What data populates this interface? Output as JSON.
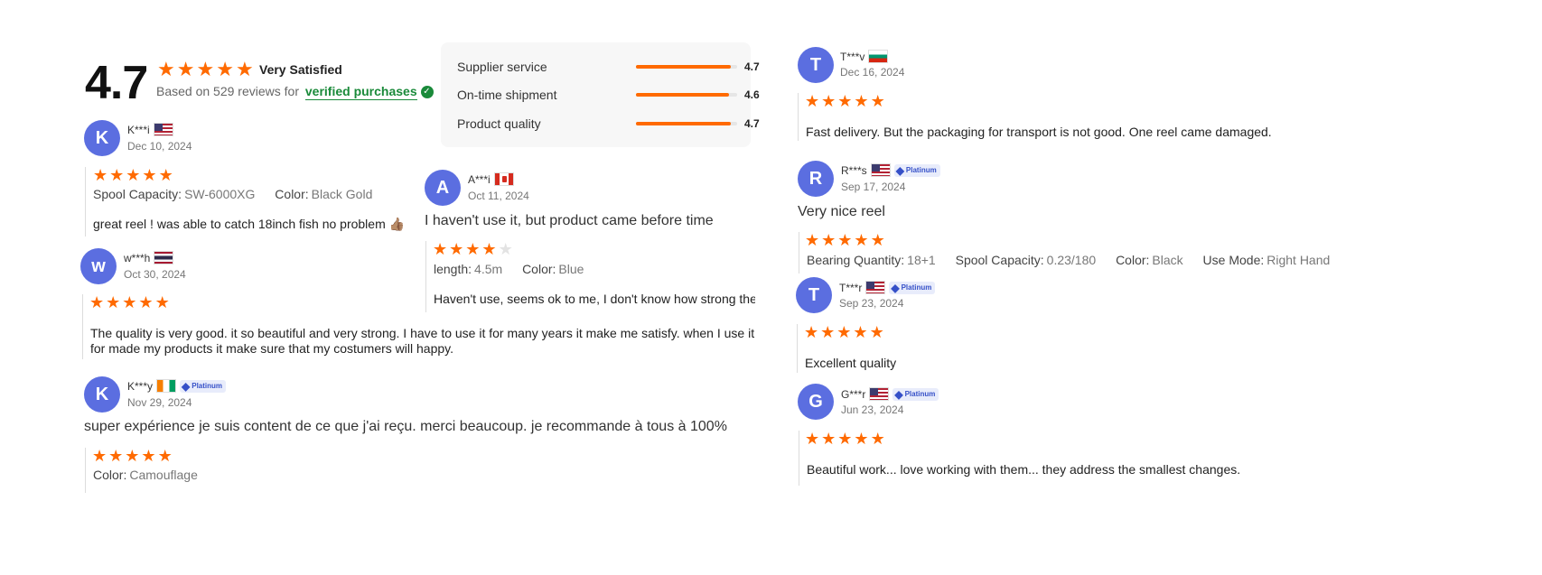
{
  "summary": {
    "rating": "4.7",
    "star_count": 5,
    "label": "Very Satisfied",
    "based_on": "Based on 529 reviews for",
    "verified_text": "verified purchases",
    "colors": {
      "star": "#ff6a00",
      "verified": "#1a8a3a",
      "avatar": "#5b6ee0"
    }
  },
  "metrics": [
    {
      "label": "Supplier service",
      "value": "4.7",
      "fraction": 0.94
    },
    {
      "label": "On-time shipment",
      "value": "4.6",
      "fraction": 0.92
    },
    {
      "label": "Product quality",
      "value": "4.7",
      "fraction": 0.94
    }
  ],
  "reviews": [
    {
      "initial": "K",
      "name": "K***i",
      "flag": "us",
      "date": "Dec 10, 2024",
      "stars": 5,
      "attrs": [
        {
          "k": "Spool Capacity:",
          "v": "SW-6000XG"
        },
        {
          "k": "Color:",
          "v": "Black Gold"
        }
      ],
      "text": "great reel ! was able to catch 18inch fish no problem 👍🏽"
    },
    {
      "initial": "A",
      "name": "A***i",
      "flag": "ca",
      "date": "Oct 11, 2024",
      "stars": 4,
      "pre_text": "I haven't use it, but product came before time",
      "attrs": [
        {
          "k": "length:",
          "v": "4.5m"
        },
        {
          "k": "Color:",
          "v": "Blue"
        }
      ],
      "text": "Haven't use, seems ok to me, I don't know how strong the r"
    },
    {
      "initial": "w",
      "name": "w***h",
      "flag": "th",
      "date": "Oct 30, 2024",
      "stars": 5,
      "text_line1": "The quality is very good. it so beautiful and very strong. I have to use it for many years it make me satisfy. when I use it",
      "text_line2": "for made my products it make sure that my costumers will happy."
    },
    {
      "initial": "K",
      "name": "K***y",
      "flag": "ci",
      "badge": "Platinum",
      "date": "Nov 29, 2024",
      "stars": 5,
      "pre_text": "super expérience je suis content de ce que j'ai reçu. merci beaucoup. je recommande à tous à 100%",
      "attrs": [
        {
          "k": "Color:",
          "v": "Camouflage"
        }
      ]
    },
    {
      "initial": "T",
      "name": "T***v",
      "flag": "bg",
      "date": "Dec 16, 2024",
      "stars": 5,
      "text": "Fast delivery. But the packaging for transport is not good. One reel came damaged."
    },
    {
      "initial": "R",
      "name": "R***s",
      "flag": "us",
      "badge": "Platinum",
      "date": "Sep 17, 2024",
      "stars": 5,
      "pre_text": "Very nice reel",
      "attrs": [
        {
          "k": "Bearing Quantity:",
          "v": "18+1"
        },
        {
          "k": "Spool Capacity:",
          "v": "0.23/180"
        },
        {
          "k": "Color:",
          "v": "Black"
        },
        {
          "k": "Use Mode:",
          "v": "Right Hand"
        }
      ]
    },
    {
      "initial": "T",
      "name": "T***r",
      "flag": "us",
      "badge": "Platinum",
      "date": "Sep 23, 2024",
      "stars": 5,
      "text": "Excellent quality"
    },
    {
      "initial": "G",
      "name": "G***r",
      "flag": "us",
      "badge": "Platinum",
      "date": "Jun 23, 2024",
      "stars": 5,
      "text": "Beautiful work... love working with them... they address the smallest changes."
    }
  ]
}
